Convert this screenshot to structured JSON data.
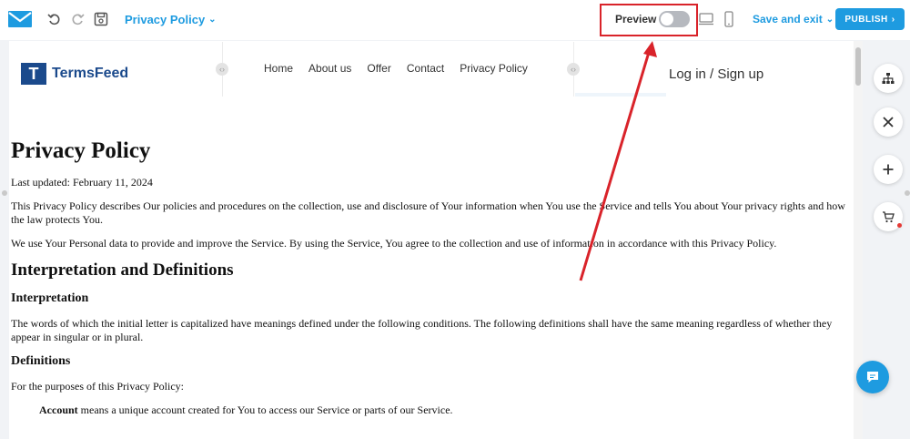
{
  "toolbar": {
    "page_selector": "Privacy Policy",
    "preview_label": "Preview",
    "save_exit_label": "Save and exit",
    "publish_label": "PUBLISH"
  },
  "site": {
    "logo_text": "TermsFeed",
    "logo_mark": "T",
    "nav": [
      "Home",
      "About us",
      "Offer",
      "Contact",
      "Privacy Policy"
    ],
    "login": "Log in / Sign up"
  },
  "document": {
    "title": "Privacy Policy",
    "last_updated": "Last updated: February 11, 2024",
    "intro_1": "This Privacy Policy describes Our policies and procedures on the collection, use and disclosure of Your information when You use the Service and tells You about Your privacy rights and how the law protects You.",
    "intro_2": "We use Your Personal data to provide and improve the Service. By using the Service, You agree to the collection and use of information in accordance with this Privacy Policy.",
    "section_1": "Interpretation and Definitions",
    "sub_1": "Interpretation",
    "interpretation_text": "The words of which the initial letter is capitalized have meanings defined under the following conditions. The following definitions shall have the same meaning regardless of whether they appear in singular or in plural.",
    "sub_2": "Definitions",
    "definitions_intro": "For the purposes of this Privacy Policy:",
    "account_term": "Account",
    "account_def": " means a unique account created for You to access our Service or parts of our Service."
  },
  "icons": {
    "app_logo": "mail-icon",
    "undo": "undo-icon",
    "redo": "redo-icon",
    "save": "save-icon",
    "desktop": "desktop-icon",
    "mobile": "mobile-icon",
    "sitemap": "sitemap-icon",
    "close": "close-icon",
    "add": "plus-icon",
    "cart": "cart-icon",
    "chat": "chat-icon"
  },
  "colors": {
    "accent": "#1e9be0",
    "annotation": "#d9232a",
    "brand": "#1b4a8c"
  }
}
